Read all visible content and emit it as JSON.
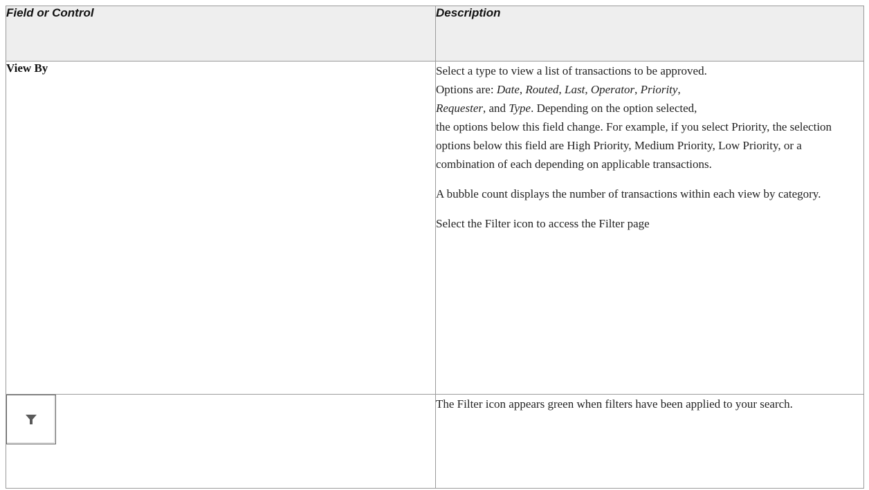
{
  "table": {
    "headers": [
      "Field or Control",
      "Description"
    ],
    "rows": [
      {
        "field": "View By",
        "description": {
          "p1_a": "Select a type to view a list of transactions to be approved.",
          "p1_b": " Options are: ",
          "opt_date": "Date",
          "sep1": ", ",
          "opt_routed": "Routed",
          "sep2": ", ",
          "opt_last": "Last",
          "sep3": ", ",
          "opt_operator": "Operator",
          "sep4": ", ",
          "opt_priority": "Priority",
          "sep5": ", ",
          "opt_requester": "Requester",
          "sep6": ", and ",
          "opt_type": "Type",
          "p1_c": ". Depending on the option selected,",
          "p1_d": " the options below this field change. For example, if you select Priority, the selection options below this field are High Priority, Medium Priority, Low Priority, or a combination of each depending on applicable transactions.",
          "p2": "A bubble count displays the number of transactions within each view by category.",
          "p3": "Select the Filter icon to access the Filter page"
        }
      },
      {
        "field_icon": "filter-icon",
        "description": {
          "p1": "The Filter icon appears green when filters have been applied to your search."
        }
      }
    ]
  }
}
